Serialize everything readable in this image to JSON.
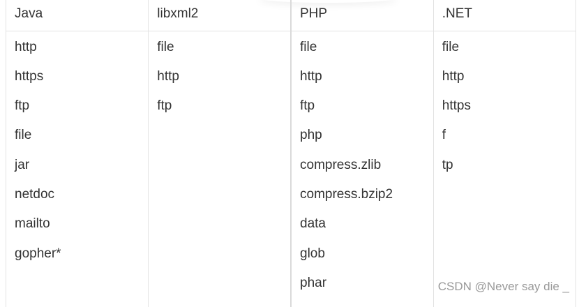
{
  "table": {
    "columns": [
      {
        "header": "Java",
        "items": [
          "http",
          "https",
          "ftp",
          "file",
          "jar",
          "netdoc",
          "mailto",
          "gopher*"
        ]
      },
      {
        "header": "libxml2",
        "items": [
          "file",
          "http",
          "ftp"
        ]
      },
      {
        "header": "PHP",
        "items": [
          "file",
          "http",
          "ftp",
          "php",
          "compress.zlib",
          "compress.bzip2",
          "data",
          "glob",
          "phar"
        ]
      },
      {
        "header": ".NET",
        "items": [
          "file",
          "http",
          "https",
          "f",
          "tp"
        ]
      }
    ]
  },
  "watermark": {
    "text": "CSDN @Never say die _"
  }
}
